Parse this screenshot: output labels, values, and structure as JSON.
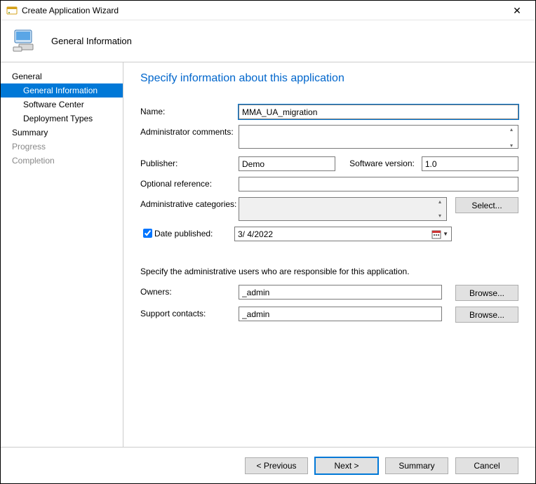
{
  "window": {
    "title": "Create Application Wizard"
  },
  "banner": {
    "title": "General Information"
  },
  "nav": {
    "general": "General",
    "general_information": "General Information",
    "software_center": "Software Center",
    "deployment_types": "Deployment Types",
    "summary": "Summary",
    "progress": "Progress",
    "completion": "Completion"
  },
  "page": {
    "heading": "Specify information about this application",
    "labels": {
      "name": "Name:",
      "admin_comments": "Administrator comments:",
      "publisher": "Publisher:",
      "software_version": "Software version:",
      "optional_reference": "Optional reference:",
      "admin_categories": "Administrative categories:",
      "date_published": "Date published:",
      "subheading": "Specify the administrative users who are responsible for this application.",
      "owners": "Owners:",
      "support_contacts": "Support contacts:"
    },
    "values": {
      "name": "MMA_UA_migration",
      "admin_comments": "",
      "publisher": "Demo",
      "software_version": "1.0",
      "optional_reference": "",
      "admin_categories": "",
      "date_published_checked": true,
      "date_published": "3/  4/2022",
      "owners": "_admin",
      "support_contacts": "_admin"
    },
    "buttons": {
      "select": "Select...",
      "browse": "Browse..."
    }
  },
  "footer": {
    "previous": "< Previous",
    "next": "Next >",
    "summary": "Summary",
    "cancel": "Cancel"
  }
}
